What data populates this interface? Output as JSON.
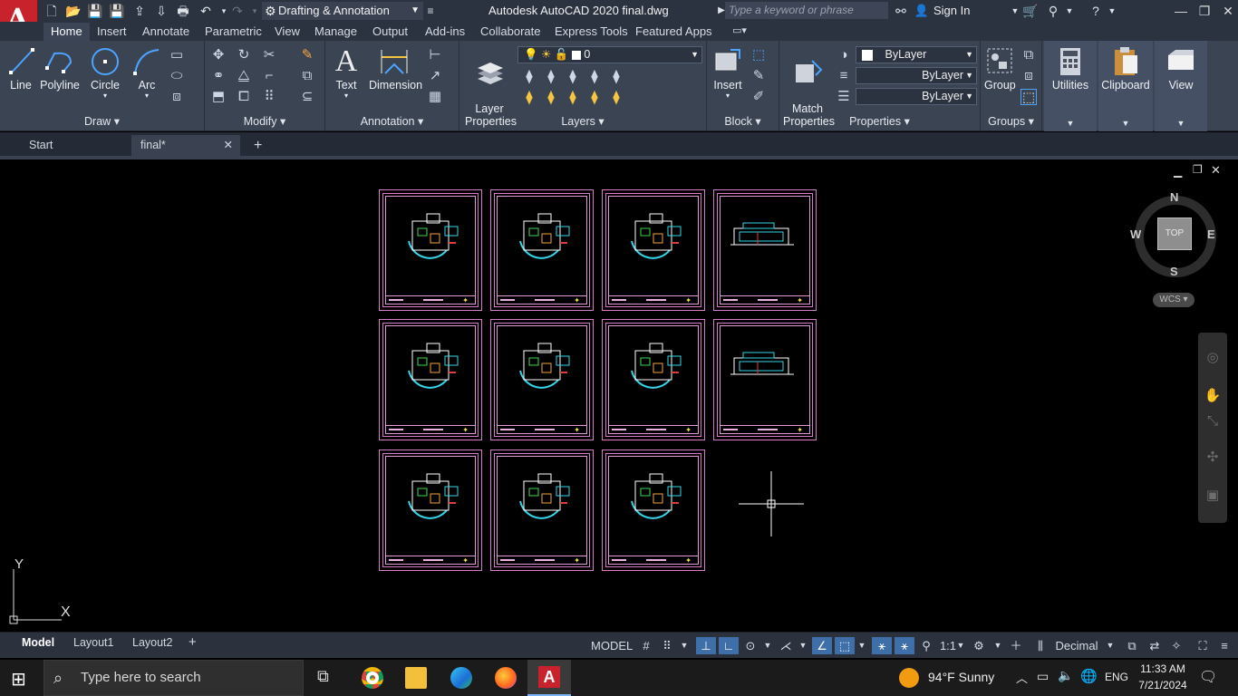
{
  "titlebar": {
    "workspace": "Drafting & Annotation",
    "app_title": "Autodesk AutoCAD 2020   final.dwg",
    "search_placeholder": "Type a keyword or phrase",
    "sign_in": "Sign In"
  },
  "ribbon_tabs": [
    "Home",
    "Insert",
    "Annotate",
    "Parametric",
    "View",
    "Manage",
    "Output",
    "Add-ins",
    "Collaborate",
    "Express Tools",
    "Featured Apps"
  ],
  "draw": {
    "title": "Draw",
    "line": "Line",
    "polyline": "Polyline",
    "circle": "Circle",
    "arc": "Arc"
  },
  "modify": {
    "title": "Modify"
  },
  "annotation": {
    "title": "Annotation",
    "text": "Text",
    "dimension": "Dimension"
  },
  "layers": {
    "title": "Layers",
    "properties": "Layer\nProperties",
    "current_layer": "0"
  },
  "block": {
    "title": "Block",
    "insert": "Insert"
  },
  "properties": {
    "title": "Properties",
    "match": "Match\nProperties",
    "color": "ByLayer",
    "linetype": "ByLayer",
    "lineweight": "ByLayer"
  },
  "groups": {
    "title": "Groups",
    "group": "Group"
  },
  "utilities": {
    "label": "Utilities"
  },
  "clipboard": {
    "label": "Clipboard"
  },
  "view": {
    "label": "View"
  },
  "doc_tabs": {
    "start": "Start",
    "final": "final*"
  },
  "viewcube": {
    "top": "TOP",
    "n": "N",
    "s": "S",
    "e": "E",
    "w": "W",
    "wcs": "WCS"
  },
  "ucs": {
    "x": "X",
    "y": "Y"
  },
  "layout_tabs": [
    "Model",
    "Layout1",
    "Layout2"
  ],
  "status": {
    "model": "MODEL",
    "scale": "1:1",
    "units": "Decimal"
  },
  "taskbar": {
    "search": "Type here to search",
    "weather": "94°F  Sunny",
    "lang": "ENG",
    "time": "11:33 AM",
    "date": "7/21/2024"
  },
  "colors": {
    "sheet_border": "#d77cc9",
    "accent": "#c8232c",
    "ribbon": "#3b4453"
  }
}
